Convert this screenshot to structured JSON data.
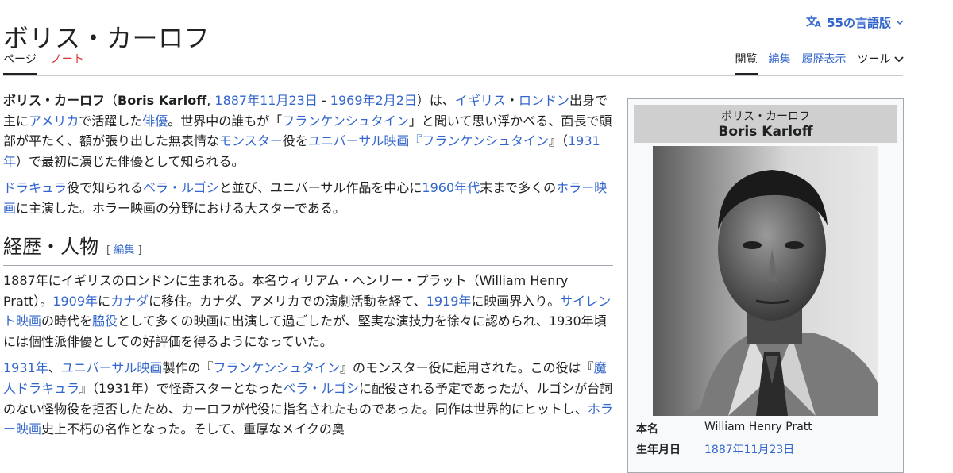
{
  "header": {
    "title": "ボリス・カーロフ",
    "lang_label": "55の言語版",
    "lang_icon": "translate-icon"
  },
  "tabs_left": [
    "ページ",
    "ノート"
  ],
  "tabs_right": [
    "閲覧",
    "編集",
    "履歴表示",
    "ツール"
  ],
  "p1": {
    "t1": "ボリス・カーロフ",
    "t2": "（",
    "t3": "Boris Karloff",
    "t4": ", ",
    "t5": "1887年11月23日",
    "t6": " - ",
    "t7": "1969年2月2日",
    "t8": "）は、",
    "t9": "イギリス",
    "t10": "・",
    "t11": "ロンドン",
    "t12": "出身で主に",
    "t13": "アメリカ",
    "t14": "で活躍した",
    "t15": "俳優",
    "t16": "。世界中の誰もが「",
    "t17": "フランケンシュタイン",
    "t18": "」と聞いて思い浮かべる、面長で頭部が平たく、額が張り出した無表情な",
    "t19": "モンスター",
    "t20": "役を",
    "t21": "ユニバーサル映画",
    "t22": "『",
    "t23": "フランケンシュタイン",
    "t24": "』（",
    "t25": "1931年",
    "t26": "）で最初に演じた俳優として知られる。"
  },
  "p2": {
    "t1": "ドラキュラ",
    "t2": "役で知られる",
    "t3": "ベラ・ルゴシ",
    "t4": "と並び、ユニバーサル作品を中心に",
    "t5": "1960年代",
    "t6": "末まで多くの",
    "t7": "ホラー映画",
    "t8": "に主演した。ホラー映画の分野における大スターである。"
  },
  "section": {
    "heading": "経歴・人物",
    "edit_open": "[ ",
    "edit_label": "編集",
    "edit_close": " ]"
  },
  "p3": {
    "t1": "1887年にイギリスのロンドンに生まれる。本名ウィリアム・ヘンリー・プラット（William Henry Pratt）。",
    "t2": "1909年",
    "t3": "に",
    "t4": "カナダ",
    "t5": "に移住。カナダ、アメリカでの演劇活動を経て、",
    "t6": "1919年",
    "t7": "に映画界入り。",
    "t8": "サイレント映画",
    "t9": "の時代を",
    "t10": "脇役",
    "t11": "として多くの映画に出演して過ごしたが、堅実な演技力を徐々に認められ、1930年頃には個性派俳優としての好評価を得るようになっていた。"
  },
  "p4": {
    "t1": "1931年",
    "t2": "、",
    "t3": "ユニバーサル映画",
    "t4": "製作の『",
    "t5": "フランケンシュタイン",
    "t6": "』のモンスター役に起用された。この役は『",
    "t7": "魔人ドラキュラ",
    "t8": "』（1931年）で怪奇スターとなった",
    "t9": "ベラ・ルゴシ",
    "t10": "に配役される予定であったが、ルゴシが台詞のない怪物役を拒否したため、カーロフが代役に指名されたものであった。同作は世界的にヒットし、",
    "t11": "ホラー映画",
    "t12": "史上不朽の名作となった。そして、重厚なメイクの奥"
  },
  "infobox": {
    "name_jp": "ボリス・カーロフ",
    "name_en": "Boris Karloff",
    "rows": [
      {
        "key": "本名",
        "value": "William Henry Pratt"
      },
      {
        "key": "生年月日",
        "value": "1887年11月23日"
      }
    ]
  }
}
